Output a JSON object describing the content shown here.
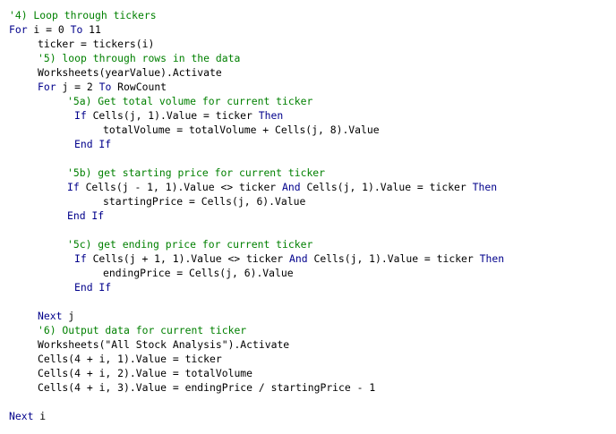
{
  "colors": {
    "keyword": "#00008b",
    "identifier": "#000000",
    "comment": "#008000",
    "background": "#ffffff"
  },
  "lines": [
    {
      "tokens": [
        {
          "t": "'4) Loop through tickers",
          "k": "cm"
        }
      ]
    },
    {
      "tokens": [
        {
          "t": "For",
          "k": "kw"
        },
        {
          "t": " i = 0 ",
          "k": "id"
        },
        {
          "t": "To",
          "k": "kw"
        },
        {
          "t": " 11",
          "k": "id"
        }
      ]
    },
    {
      "tokens": [
        {
          "t": "ticker = tickers(i)",
          "k": "id"
        }
      ]
    },
    {
      "tokens": [
        {
          "t": "'5) loop through rows in the data",
          "k": "cm"
        }
      ]
    },
    {
      "tokens": [
        {
          "t": "Worksheets(yearValue).Activate",
          "k": "id"
        }
      ]
    },
    {
      "tokens": [
        {
          "t": "For",
          "k": "kw"
        },
        {
          "t": " j = 2 ",
          "k": "id"
        },
        {
          "t": "To",
          "k": "kw"
        },
        {
          "t": " RowCount",
          "k": "id"
        }
      ]
    },
    {
      "tokens": [
        {
          "t": "'5a) Get total volume for current ticker",
          "k": "cm"
        }
      ]
    },
    {
      "tokens": [
        {
          "t": "If",
          "k": "kw"
        },
        {
          "t": " Cells(j, 1).Value = ticker ",
          "k": "id"
        },
        {
          "t": "Then",
          "k": "kw"
        }
      ]
    },
    {
      "tokens": [
        {
          "t": "totalVolume = totalVolume + Cells(j, 8).Value",
          "k": "id"
        }
      ]
    },
    {
      "tokens": [
        {
          "t": "End If",
          "k": "kw"
        }
      ]
    },
    {
      "tokens": []
    },
    {
      "tokens": [
        {
          "t": "'5b) get starting price for current ticker",
          "k": "cm"
        }
      ]
    },
    {
      "tokens": [
        {
          "t": "If",
          "k": "kw"
        },
        {
          "t": " Cells(j - 1, 1).Value <> ticker ",
          "k": "id"
        },
        {
          "t": "And",
          "k": "kw"
        },
        {
          "t": " Cells(j, 1).Value = ticker ",
          "k": "id"
        },
        {
          "t": "Then",
          "k": "kw"
        }
      ]
    },
    {
      "tokens": [
        {
          "t": "startingPrice = Cells(j, 6).Value",
          "k": "id"
        }
      ]
    },
    {
      "tokens": [
        {
          "t": "End If",
          "k": "kw"
        }
      ]
    },
    {
      "tokens": []
    },
    {
      "tokens": [
        {
          "t": "'5c) get ending price for current ticker",
          "k": "cm"
        }
      ]
    },
    {
      "tokens": [
        {
          "t": "If",
          "k": "kw"
        },
        {
          "t": " Cells(j + 1, 1).Value <> ticker ",
          "k": "id"
        },
        {
          "t": "And",
          "k": "kw"
        },
        {
          "t": " Cells(j, 1).Value = ticker ",
          "k": "id"
        },
        {
          "t": "Then",
          "k": "kw"
        }
      ]
    },
    {
      "tokens": [
        {
          "t": "endingPrice = Cells(j, 6).Value",
          "k": "id"
        }
      ]
    },
    {
      "tokens": [
        {
          "t": "End If",
          "k": "kw"
        }
      ]
    },
    {
      "tokens": []
    },
    {
      "tokens": [
        {
          "t": "Next",
          "k": "kw"
        },
        {
          "t": " j",
          "k": "id"
        }
      ]
    },
    {
      "tokens": [
        {
          "t": "'6) Output data for current ticker",
          "k": "cm"
        }
      ]
    },
    {
      "tokens": [
        {
          "t": "Worksheets(\"All Stock Analysis\").Activate",
          "k": "id"
        }
      ]
    },
    {
      "tokens": [
        {
          "t": "Cells(4 + i, 1).Value = ticker",
          "k": "id"
        }
      ]
    },
    {
      "tokens": [
        {
          "t": "Cells(4 + i, 2).Value = totalVolume",
          "k": "id"
        }
      ]
    },
    {
      "tokens": [
        {
          "t": "Cells(4 + i, 3).Value = endingPrice / startingPrice - 1",
          "k": "id"
        }
      ]
    },
    {
      "tokens": []
    },
    {
      "tokens": [
        {
          "t": "Next",
          "k": "kw"
        },
        {
          "t": " i",
          "k": "id"
        }
      ]
    }
  ]
}
